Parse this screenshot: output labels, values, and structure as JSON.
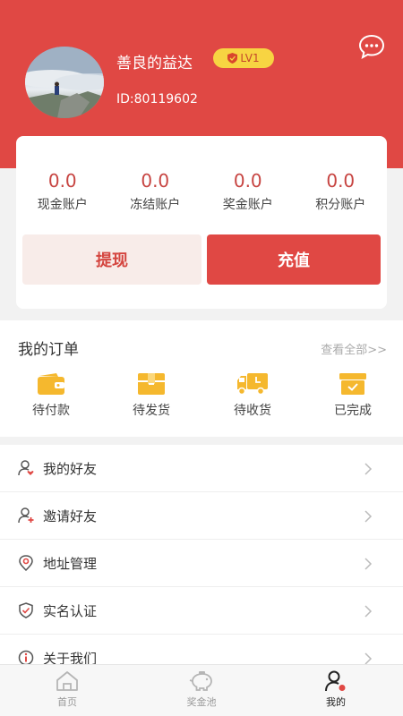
{
  "profile": {
    "name": "善良的益达",
    "level": "LV1",
    "id": "ID:80119602"
  },
  "accounts": [
    {
      "value": "0.0",
      "label": "现金账户"
    },
    {
      "value": "0.0",
      "label": "冻结账户"
    },
    {
      "value": "0.0",
      "label": "奖金账户"
    },
    {
      "value": "0.0",
      "label": "积分账户"
    }
  ],
  "actions": {
    "withdraw": "提现",
    "recharge": "充值"
  },
  "orders": {
    "title": "我的订单",
    "view_all": "查看全部>>",
    "items": [
      {
        "label": "待付款",
        "icon": "wallet-icon"
      },
      {
        "label": "待发货",
        "icon": "box-icon"
      },
      {
        "label": "待收货",
        "icon": "truck-icon"
      },
      {
        "label": "已完成",
        "icon": "archive-check-icon"
      }
    ]
  },
  "menu": [
    {
      "label": "我的好友",
      "icon": "friend-icon"
    },
    {
      "label": "邀请好友",
      "icon": "invite-icon"
    },
    {
      "label": "地址管理",
      "icon": "location-icon"
    },
    {
      "label": "实名认证",
      "icon": "shield-check-icon"
    },
    {
      "label": "关于我们",
      "icon": "info-icon"
    }
  ],
  "tabs": [
    {
      "label": "首页",
      "icon": "home-icon",
      "active": false
    },
    {
      "label": "奖金池",
      "icon": "piggy-bank-icon",
      "active": false
    },
    {
      "label": "我的",
      "icon": "user-icon",
      "active": true
    }
  ],
  "colors": {
    "brand_red": "#e04844",
    "badge_yellow": "#f7d442",
    "order_icon_yellow": "#f5b82e"
  }
}
